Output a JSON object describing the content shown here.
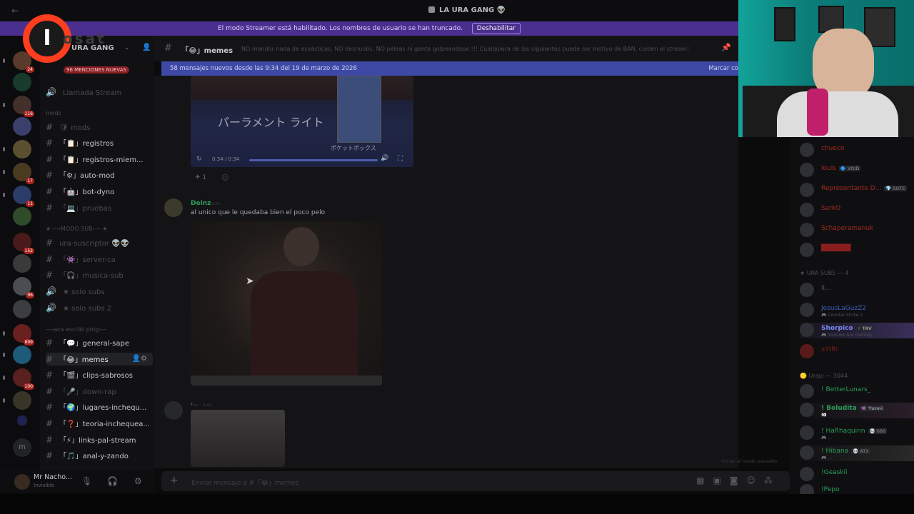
{
  "window": {
    "title": "LA URA GANG 👽",
    "back_arrow": "←"
  },
  "banner": {
    "text": "El modo Streamer está habilitado. Los nombres de usuario se han truncado.",
    "button": "Deshabilitar"
  },
  "logo": {
    "letter": "I",
    "text": "osat",
    "color": "#ff3d1f"
  },
  "rail": {
    "badges": [
      "24",
      "116",
      "17",
      "11",
      "152",
      "96",
      "899",
      "100"
    ]
  },
  "sidebar": {
    "server_name": "URA GANG",
    "mentions_badge": "96 MENCIONES NUEVAS",
    "top_channels": [
      {
        "label": "Llamada Stream"
      }
    ],
    "categories": {
      "mods": "mods",
      "modo_sub": "★ ―‹MODO SUB›― ★",
      "aca_escribi": "―‹aca escribi ping›―"
    },
    "channels": [
      {
        "label": "🛡 mods"
      },
      {
        "label": "「📋」registros"
      },
      {
        "label": "「📋」registros-miem..."
      },
      {
        "label": "「⚙」auto-mod"
      },
      {
        "label": "「🤖」bot-dyno"
      },
      {
        "label": "「💻」pruebas"
      },
      {
        "label": "ura-suscriptor 👽👽"
      },
      {
        "label": "「👾」server-ca"
      },
      {
        "label": "「🎧」musica-sub"
      },
      {
        "label": "★ solo subs"
      },
      {
        "label": "★ solo subs 2"
      },
      {
        "label": "「💬」general-sape"
      },
      {
        "label": "「😂」memes"
      },
      {
        "label": "「🎬」clips-sabrosos"
      },
      {
        "label": "「🎤」down-rap"
      },
      {
        "label": "「🌍」lugares-inchequ..."
      },
      {
        "label": "「❓」teoria-inchequea..."
      },
      {
        "label": "「⚡」links-pal-stream"
      },
      {
        "label": "「🎵」anal-y-zando"
      }
    ]
  },
  "user": {
    "name": "Mr Nacho...",
    "status": "Invisible"
  },
  "chat": {
    "channel": "「😂」memes",
    "topic": "NO mandar nada de esvásticas, NO desnudos, NO peleas ni gente golpeandose !!! Cualquiera de las siguientes puede ser motivo de BAN, cuiden el stream!",
    "new_messages": "58 mensajes nuevos desde las 9:34 del 19 de marzo de 2026",
    "mark_read": "Marcar co",
    "video": {
      "jp_text": "パーラメント ライト",
      "jp_sub": "ポケットボックス",
      "time": "0:34 / 0:34",
      "reaction_count": "1"
    },
    "message": {
      "author": "Deinz",
      "time": "a.m.",
      "text": "al unico que le quedaba bien el poco pelo"
    },
    "message2": {
      "author": "r...",
      "time": "a.m."
    },
    "composer_placeholder": "Enviar mensaje a #「😂」memes",
    "paused": "Iniciar al modo pausado"
  },
  "members": {
    "list": [
      {
        "name": "chueco",
        "color": "#c0392b"
      },
      {
        "name": "louis",
        "color": "#c0392b",
        "tag": "🔷 VOID"
      },
      {
        "name": "Representante D...",
        "color": "#c0392b",
        "tag": "💎 SOTE"
      },
      {
        "name": "SarkO",
        "color": "#c0392b"
      },
      {
        "name": "Schaperamanuk",
        "color": "#c0392b"
      },
      {
        "name": "",
        "color": "#c0392b"
      }
    ],
    "category_subs": "★ URA SUBS — 4",
    "subs": [
      {
        "name": "li...",
        "color": "#5a5c62",
        "sub": ""
      },
      {
        "name": "JesusLaGuzZ2",
        "color": "#3e5fc0",
        "sub": "🎮 Counter-Strike 2"
      },
      {
        "name": "Shorpico",
        "color": "#6c7df0",
        "sub": "🎮 Youtube Are Gaming",
        "tag": "⚡ TAV"
      },
      {
        "name": "xYtRi",
        "color": "#c0392b",
        "sub": ""
      }
    ],
    "category_urajos": "🟡 Urajo — 3044",
    "urajos": [
      {
        "name": "! BetterLunars_",
        "color": "#2ecc71",
        "sub": ""
      },
      {
        "name": "! Boludita",
        "color": "#2ecc71",
        "sub": "👀",
        "tag": "👾 Yunni"
      },
      {
        "name": "! HaRhaquinn",
        "color": "#2ecc71",
        "sub": "🎮 ...",
        "tag": "💀 666"
      },
      {
        "name": "! Hibana",
        "color": "#2ecc71",
        "sub": "🎮 ...",
        "tag": "💀 ATX"
      },
      {
        "name": "!Geaskii",
        "color": "#2ecc71",
        "sub": ""
      },
      {
        "name": "!Pepo",
        "color": "#2ecc71",
        "sub": ""
      }
    ]
  }
}
